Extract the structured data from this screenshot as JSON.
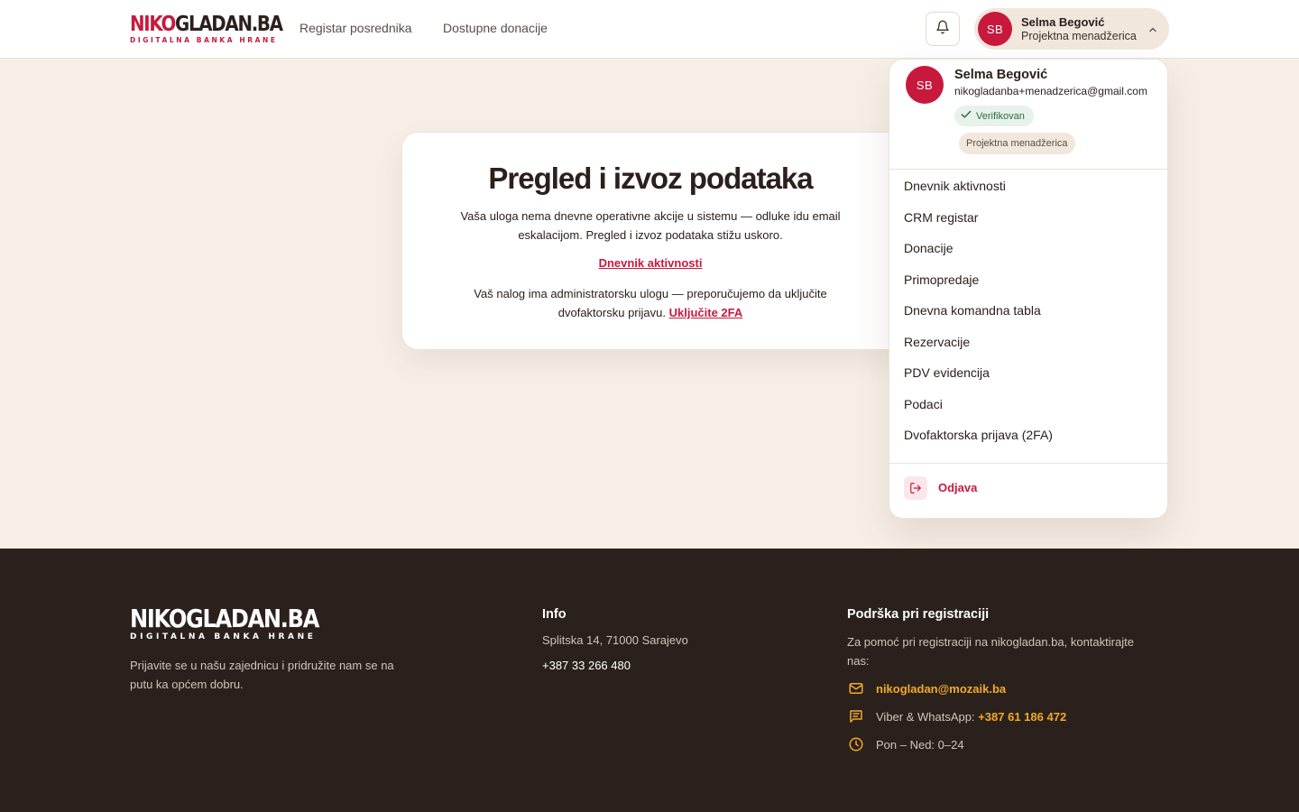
{
  "header": {
    "logo": {
      "part_red": "NIKO",
      "part_dark": "GLADAN.BA",
      "tagline": "DIGITALNA BANKA HRANE"
    },
    "nav": [
      {
        "label": "Registar posrednika"
      },
      {
        "label": "Dostupne donacije"
      }
    ],
    "bell_icon": "bell-icon",
    "user": {
      "initials": "SB",
      "name": "Selma Begović",
      "role": "Projektna menadžerica"
    }
  },
  "main": {
    "title": "Pregled i izvoz podataka",
    "description": "Vaša uloga nema dnevne operativne akcije u sistemu — odluke idu email eskalacijom. Pregled i izvoz podataka stižu uskoro.",
    "activity_link": "Dnevnik aktivnosti",
    "admin_note": "Vaš nalog ima administratorsku ulogu — preporučujemo da uključite dvofaktorsku prijavu.",
    "admin_note_link": "Uključite 2FA"
  },
  "dropdown": {
    "initials": "SB",
    "name": "Selma Begović",
    "email": "nikogladanba+menadzerica@gmail.com",
    "verified_badge": "Verifikovan",
    "role_badge": "Projektna menadžerica",
    "items": [
      {
        "label": "Dnevnik aktivnosti"
      },
      {
        "label": "CRM registar"
      },
      {
        "label": "Donacije"
      },
      {
        "label": "Primopredaje"
      },
      {
        "label": "Dnevna komandna tabla"
      },
      {
        "label": "Rezervacije"
      },
      {
        "label": "PDV evidencija"
      },
      {
        "label": "Podaci"
      },
      {
        "label": "Dvofaktorska prijava (2FA)"
      }
    ],
    "logout": "Odjava"
  },
  "footer": {
    "logo": {
      "line1": "NIKOGLADAN.BA",
      "tagline": "DIGITALNA BANKA HRANE"
    },
    "description": "Prijavite se u našu zajednicu i pridružite nam se na putu ka općem dobru.",
    "info_heading": "Info",
    "address": "Splitska 14, 71000 Sarajevo",
    "phone": "+387 33 266 480",
    "support_heading": "Podrška pri registraciji",
    "support_text": "Za pomoć pri registraciji na nikogladan.ba, kontaktirajte nas:",
    "email": "nikogladan@mozaik.ba",
    "messaging_label": "Viber & WhatsApp:",
    "messaging_phone": "+387 61 186 472",
    "hours": "Pon – Ned: 0–24"
  },
  "colors": {
    "brand_red": "#c8193c",
    "background": "#f7efe6",
    "footer_bg": "#2b211c",
    "accent_orange": "#f0a92a",
    "verified_green": "#2f6b43"
  }
}
